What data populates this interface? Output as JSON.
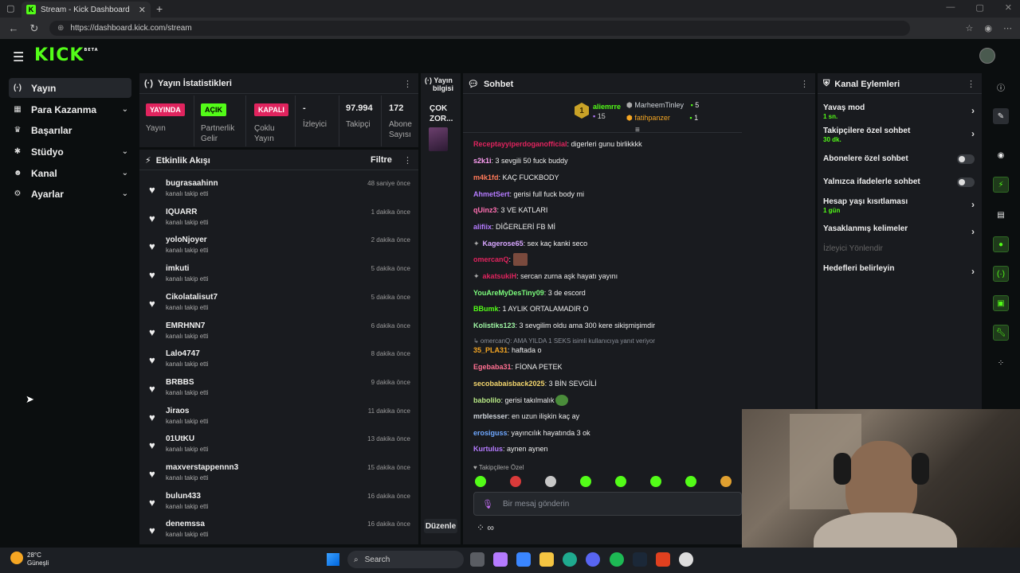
{
  "browser": {
    "tab_title": "Stream - Kick Dashboard",
    "url": "https://dashboard.kick.com/stream",
    "fav_letter": "K"
  },
  "header": {
    "logo": "KICK",
    "logo_badge": "BETA"
  },
  "sidebar": {
    "items": [
      {
        "label": "Yayın",
        "icon": "broadcast-icon",
        "active": true
      },
      {
        "label": "Para Kazanma",
        "icon": "wallet-icon",
        "chevron": true
      },
      {
        "label": "Başarılar",
        "icon": "trophy-icon"
      },
      {
        "label": "Stüdyo",
        "icon": "gear-icon",
        "chevron": true
      },
      {
        "label": "Kanal",
        "icon": "user-icon",
        "chevron": true
      },
      {
        "label": "Ayarlar",
        "icon": "settings-icon",
        "chevron": true
      }
    ]
  },
  "stats": {
    "title": "Yayın İstatistikleri",
    "live_badge": "YAYINDA",
    "live_label": "Yayın",
    "partner_badge": "AÇIK",
    "partner_label_1": "Partnerlik",
    "partner_label_2": "Gelir",
    "multi_badge": "KAPALI",
    "multi_label_1": "Çoklu",
    "multi_label_2": "Yayın",
    "viewers_value": "-",
    "viewers_label": "İzleyici",
    "followers_value": "97.994",
    "followers_label": "Takipçi",
    "subs_value": "172",
    "subs_label_1": "Abone",
    "subs_label_2": "Sayısı"
  },
  "activity": {
    "title": "Etkinlik Akışı",
    "filter": "Filtre",
    "items": [
      {
        "name": "bugrasaahinn",
        "sub": "kanalı takip etti",
        "time": "48 saniye önce"
      },
      {
        "name": "IQUARR",
        "sub": "kanalı takip etti",
        "time": "1 dakika önce"
      },
      {
        "name": "yoloNjoyer",
        "sub": "kanalı takip etti",
        "time": "2 dakika önce"
      },
      {
        "name": "imkuti",
        "sub": "kanalı takip etti",
        "time": "5 dakika önce"
      },
      {
        "name": "Cikolatalisut7",
        "sub": "kanalı takip etti",
        "time": "5 dakika önce"
      },
      {
        "name": "EMRHNN7",
        "sub": "kanalı takip etti",
        "time": "6 dakika önce"
      },
      {
        "name": "Lalo4747",
        "sub": "kanalı takip etti",
        "time": "8 dakika önce"
      },
      {
        "name": "BRBBS",
        "sub": "kanalı takip etti",
        "time": "9 dakika önce"
      },
      {
        "name": "Jiraos",
        "sub": "kanalı takip etti",
        "time": "11 dakika önce"
      },
      {
        "name": "01UtKU",
        "sub": "kanalı takip etti",
        "time": "13 dakika önce"
      },
      {
        "name": "maxverstappennn3",
        "sub": "kanalı takip etti",
        "time": "15 dakika önce"
      },
      {
        "name": "bulun433",
        "sub": "kanalı takip etti",
        "time": "16 dakika önce"
      },
      {
        "name": "denemssa",
        "sub": "kanalı takip etti",
        "time": "16 dakika önce"
      }
    ]
  },
  "info": {
    "title_1": "Yayın",
    "title_2": "bilgisi",
    "stream_title_1": "ÇOK",
    "stream_title_2": "ZOR...",
    "edit": "Düzenle"
  },
  "chat": {
    "title": "Sohbet",
    "leaders": [
      {
        "rank": "1",
        "name": "aliemrre",
        "count": "15",
        "color": "#53fc18"
      },
      {
        "rank": "",
        "name": "MarheemTinley",
        "count": "5",
        "color": "#cfd4da"
      },
      {
        "rank": "",
        "name": "fatihpanzer",
        "count": "1",
        "color": "#f5a623"
      }
    ],
    "messages": [
      {
        "user": "Receptayyiperdoganofficial",
        "color": "#e0245e",
        "text": ": digerleri gunu birlikkkk"
      },
      {
        "user": "s2k1i",
        "color": "#ff9ff3",
        "text": ": 3 sevgili 50 fuck buddy"
      },
      {
        "user": "m4k1fd",
        "color": "#ff7a59",
        "text": ": KAÇ FUCKBODY"
      },
      {
        "user": "AhmetSert",
        "color": "#b57bff",
        "text": ": gerisi full fuck body mi"
      },
      {
        "user": "qUinz3",
        "color": "#ff6fb1",
        "text": ": 3 VE KATLARI"
      },
      {
        "user": "alifiix",
        "color": "#b57bff",
        "text": ": DİĞERLERİ FB Mİ"
      },
      {
        "user": "Kagerose65",
        "color": "#d7a6ff",
        "text": ": sex kaç kanki seco"
      },
      {
        "user": "omercanQ",
        "color": "#e0245e",
        "text": ":"
      },
      {
        "user": "akatsukiH",
        "color": "#e0245e",
        "text": ": sercan zurna aşk hayatı yayını"
      },
      {
        "user": "YouAreMyDesTiny09",
        "color": "#7cfc7c",
        "text": ": 3 de escord"
      },
      {
        "user": "BBumk",
        "color": "#53fc18",
        "text": ": 1 AYLIK ORTALAMADIR O"
      },
      {
        "user": "Kolistiks123",
        "color": "#9ff5a4",
        "text": ": 3 sevgilim oldu ama 300 kere sikişmişimdir"
      },
      {
        "user": "35_PLA31",
        "color": "#f5a623",
        "text": ": haftada o"
      },
      {
        "user": "Egebaba31",
        "color": "#ff6f91",
        "text": ": FİONA PETEK"
      },
      {
        "user": "secobabaisback2025",
        "color": "#f5d76e",
        "text": ": 3 BİN SEVGİLİ"
      },
      {
        "user": "babolilo",
        "color": "#b8e986",
        "text": ": gerisi takılmalık"
      },
      {
        "user": "mrblesser",
        "color": "#cfd4da",
        "text": ": en uzun ilişkin kaç ay"
      },
      {
        "user": "erosiguss",
        "color": "#6fa8ff",
        "text": ": yayıncılık hayatında 3 ok"
      },
      {
        "user": "Kurtulus",
        "color": "#b57bff",
        "text": ": aynen aynen"
      }
    ],
    "reply_note": "↳ omercanQ: AMA YILDA 1 SEKS isimli kullanıcıya yanıt veriyor",
    "followers_only": "Takipçilere Özel",
    "input_placeholder": "Bir mesaj gönderin",
    "infinity": "∞"
  },
  "actions": {
    "title": "Kanal Eylemleri",
    "items": [
      {
        "label": "Yavaş mod",
        "sub": "1 sn.",
        "type": "arrow"
      },
      {
        "label": "Takipçilere özel sohbet",
        "sub": "30 dk.",
        "type": "arrow"
      },
      {
        "label": "Abonelere özel sohbet",
        "sub": "",
        "type": "toggle"
      },
      {
        "label": "Yalnızca ifadelerle sohbet",
        "sub": "",
        "type": "toggle"
      },
      {
        "label": "Hesap yaşı kısıtlaması",
        "sub": "1 gün",
        "type": "arrow"
      },
      {
        "label": "Yasaklanmış kelimeler",
        "sub": "",
        "type": "arrow"
      },
      {
        "label": "İzleyici Yönlendir",
        "sub": "",
        "type": "disabled"
      },
      {
        "label": "Hedefleri belirleyin",
        "sub": "",
        "type": "arrow"
      }
    ]
  },
  "taskbar": {
    "weather_temp": "28°C",
    "weather_desc": "Güneşli",
    "search": "Search"
  },
  "colors": {
    "accent": "#53fc18",
    "live": "#e0245e"
  }
}
